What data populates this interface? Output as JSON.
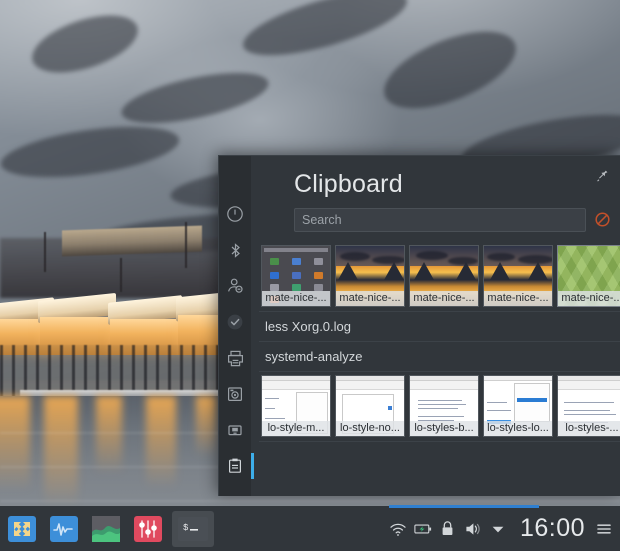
{
  "desktop": {
    "wallpaper_name": "snowy-village-harbour-photo",
    "wallpaper_colors": [
      "#7d848c",
      "#4a5059",
      "#f2b35e",
      "#8a9096"
    ]
  },
  "panel": {
    "title": "Clipboard",
    "pin_icon": "pin-icon",
    "search": {
      "placeholder": "Search",
      "value": ""
    },
    "clear_icon": "clear-history-icon",
    "sidebar": [
      {
        "name": "sidebar-item-power",
        "icon": "power-icon",
        "active": false
      },
      {
        "name": "sidebar-item-bluetooth",
        "icon": "bluetooth-icon",
        "active": false
      },
      {
        "name": "sidebar-item-user",
        "icon": "user-account-icon",
        "active": false
      },
      {
        "name": "sidebar-item-updates",
        "icon": "check-circle-icon",
        "active": false
      },
      {
        "name": "sidebar-item-printers",
        "icon": "printer-icon",
        "active": false
      },
      {
        "name": "sidebar-item-camera",
        "icon": "camera-icon",
        "active": false
      },
      {
        "name": "sidebar-item-removable",
        "icon": "usb-drive-icon",
        "active": false
      },
      {
        "name": "sidebar-item-clipboard",
        "icon": "clipboard-icon",
        "active": true
      }
    ],
    "entries": [
      {
        "type": "thumbnails",
        "items": [
          {
            "label": "mate-nice-...",
            "art": "desktop",
            "selected": false
          },
          {
            "label": "mate-nice-...",
            "art": "sunset",
            "selected": false
          },
          {
            "label": "mate-nice-...",
            "art": "sunset",
            "selected": false
          },
          {
            "label": "mate-nice-...",
            "art": "sunset",
            "selected": false
          },
          {
            "label": "mate-nice-...",
            "art": "green",
            "selected": true
          }
        ]
      },
      {
        "type": "text",
        "label": "less Xorg.0.log"
      },
      {
        "type": "text",
        "label": "systemd-analyze"
      },
      {
        "type": "thumbnails",
        "items": [
          {
            "label": "lo-style-m...",
            "art": "doc-a",
            "selected": false
          },
          {
            "label": "lo-style-no...",
            "art": "doc-b",
            "selected": false
          },
          {
            "label": "lo-styles-b...",
            "art": "doc-c",
            "selected": false
          },
          {
            "label": "lo-styles-lo...",
            "art": "doc-d",
            "selected": false
          },
          {
            "label": "lo-styles-...",
            "art": "doc-e",
            "selected": false
          }
        ]
      }
    ]
  },
  "taskbar": {
    "launchers": [
      {
        "name": "taskbar-vmware",
        "icon": "network-arrows-icon",
        "running": false
      },
      {
        "name": "taskbar-wireshark",
        "icon": "waveform-icon",
        "running": false
      },
      {
        "name": "taskbar-system-monitor",
        "icon": "area-graph-icon",
        "running": false
      },
      {
        "name": "taskbar-volume-mixer",
        "icon": "sliders-icon",
        "running": false
      },
      {
        "name": "taskbar-terminal",
        "icon": "terminal-icon",
        "running": true
      }
    ],
    "tray": [
      {
        "name": "tray-network",
        "icon": "wifi-icon"
      },
      {
        "name": "tray-battery",
        "icon": "battery-charging-icon"
      },
      {
        "name": "tray-lock",
        "icon": "lock-icon"
      },
      {
        "name": "tray-volume",
        "icon": "speaker-icon"
      },
      {
        "name": "tray-expand",
        "icon": "chevron-down-icon"
      }
    ],
    "clock": "16:00",
    "menu_icon": "hamburger-icon",
    "accent_color": "#3daee9",
    "highlight_bar_color": "#2f7fd0"
  }
}
